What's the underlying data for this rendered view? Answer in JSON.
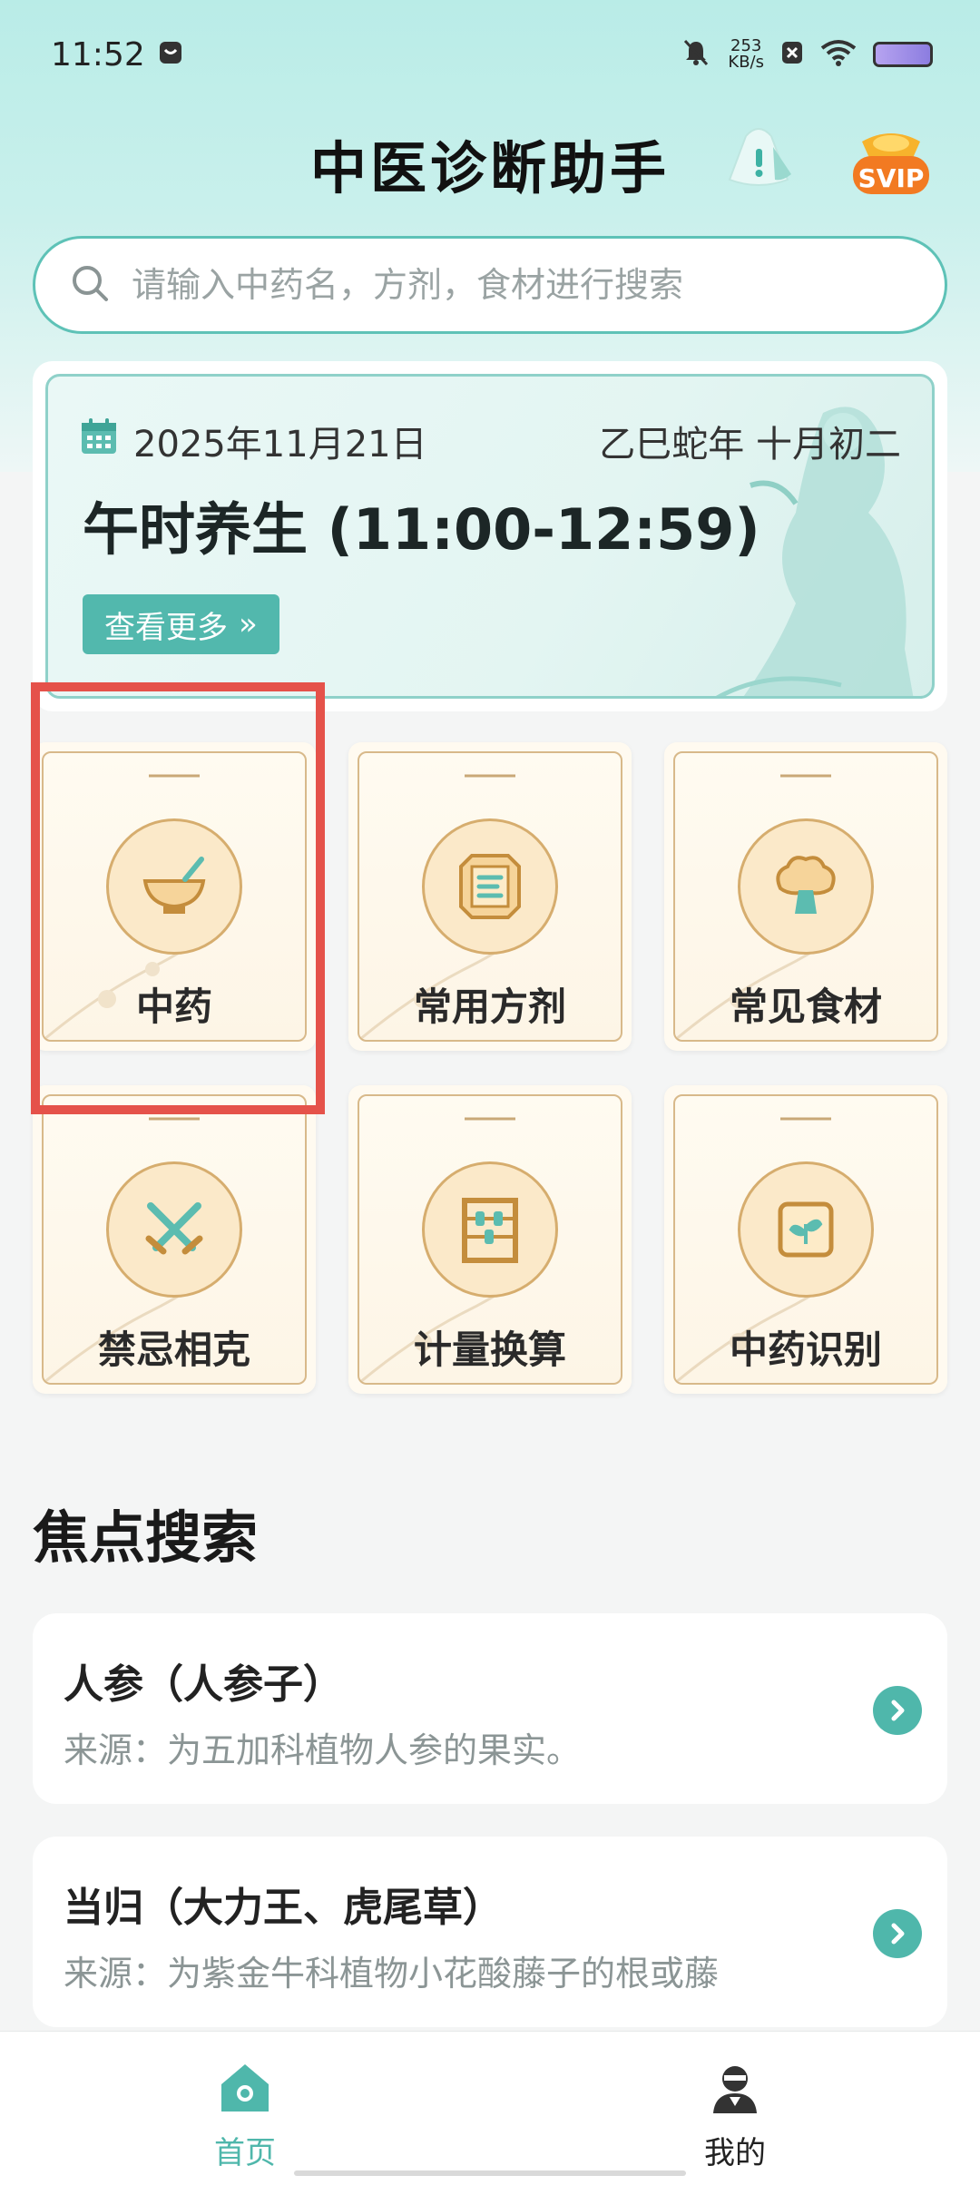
{
  "status_bar": {
    "time": "11:52",
    "net_speed_value": "253",
    "net_speed_unit": "KB/s"
  },
  "header": {
    "title": "中医诊断助手",
    "svip_label": "SVIP"
  },
  "search": {
    "placeholder": "请输入中药名，方剂，食材进行搜索"
  },
  "date_card": {
    "date": "2025年11月21日",
    "lunar": "乙巳蛇年 十月初二",
    "slogan": "午时养生 (11:00-12:59)",
    "more_label": "查看更多",
    "more_chevron": "»"
  },
  "categories": [
    {
      "label": "中药",
      "icon": "herb-bowl-icon"
    },
    {
      "label": "常用方剂",
      "icon": "prescription-scroll-icon"
    },
    {
      "label": "常见食材",
      "icon": "mushroom-icon"
    },
    {
      "label": "禁忌相克",
      "icon": "crossed-swords-icon"
    },
    {
      "label": "计量换算",
      "icon": "abacus-icon"
    },
    {
      "label": "中药识别",
      "icon": "scan-leaf-icon"
    }
  ],
  "focus": {
    "title": "焦点搜索",
    "items": [
      {
        "name": "人参（人参子）",
        "desc": "来源：为五加科植物人参的果实。"
      },
      {
        "name": "当归（大力王、虎尾草）",
        "desc": "来源：为紫金牛科植物小花酸藤子的根或藤"
      }
    ]
  },
  "bottom_nav": {
    "items": [
      {
        "label": "首页",
        "icon": "home-icon",
        "active": true
      },
      {
        "label": "我的",
        "icon": "profile-icon",
        "active": false
      }
    ]
  },
  "colors": {
    "accent": "#52b8ad",
    "highlight": "#e5524a",
    "tile_border": "#d8b98a",
    "svip": "#f27a22"
  }
}
